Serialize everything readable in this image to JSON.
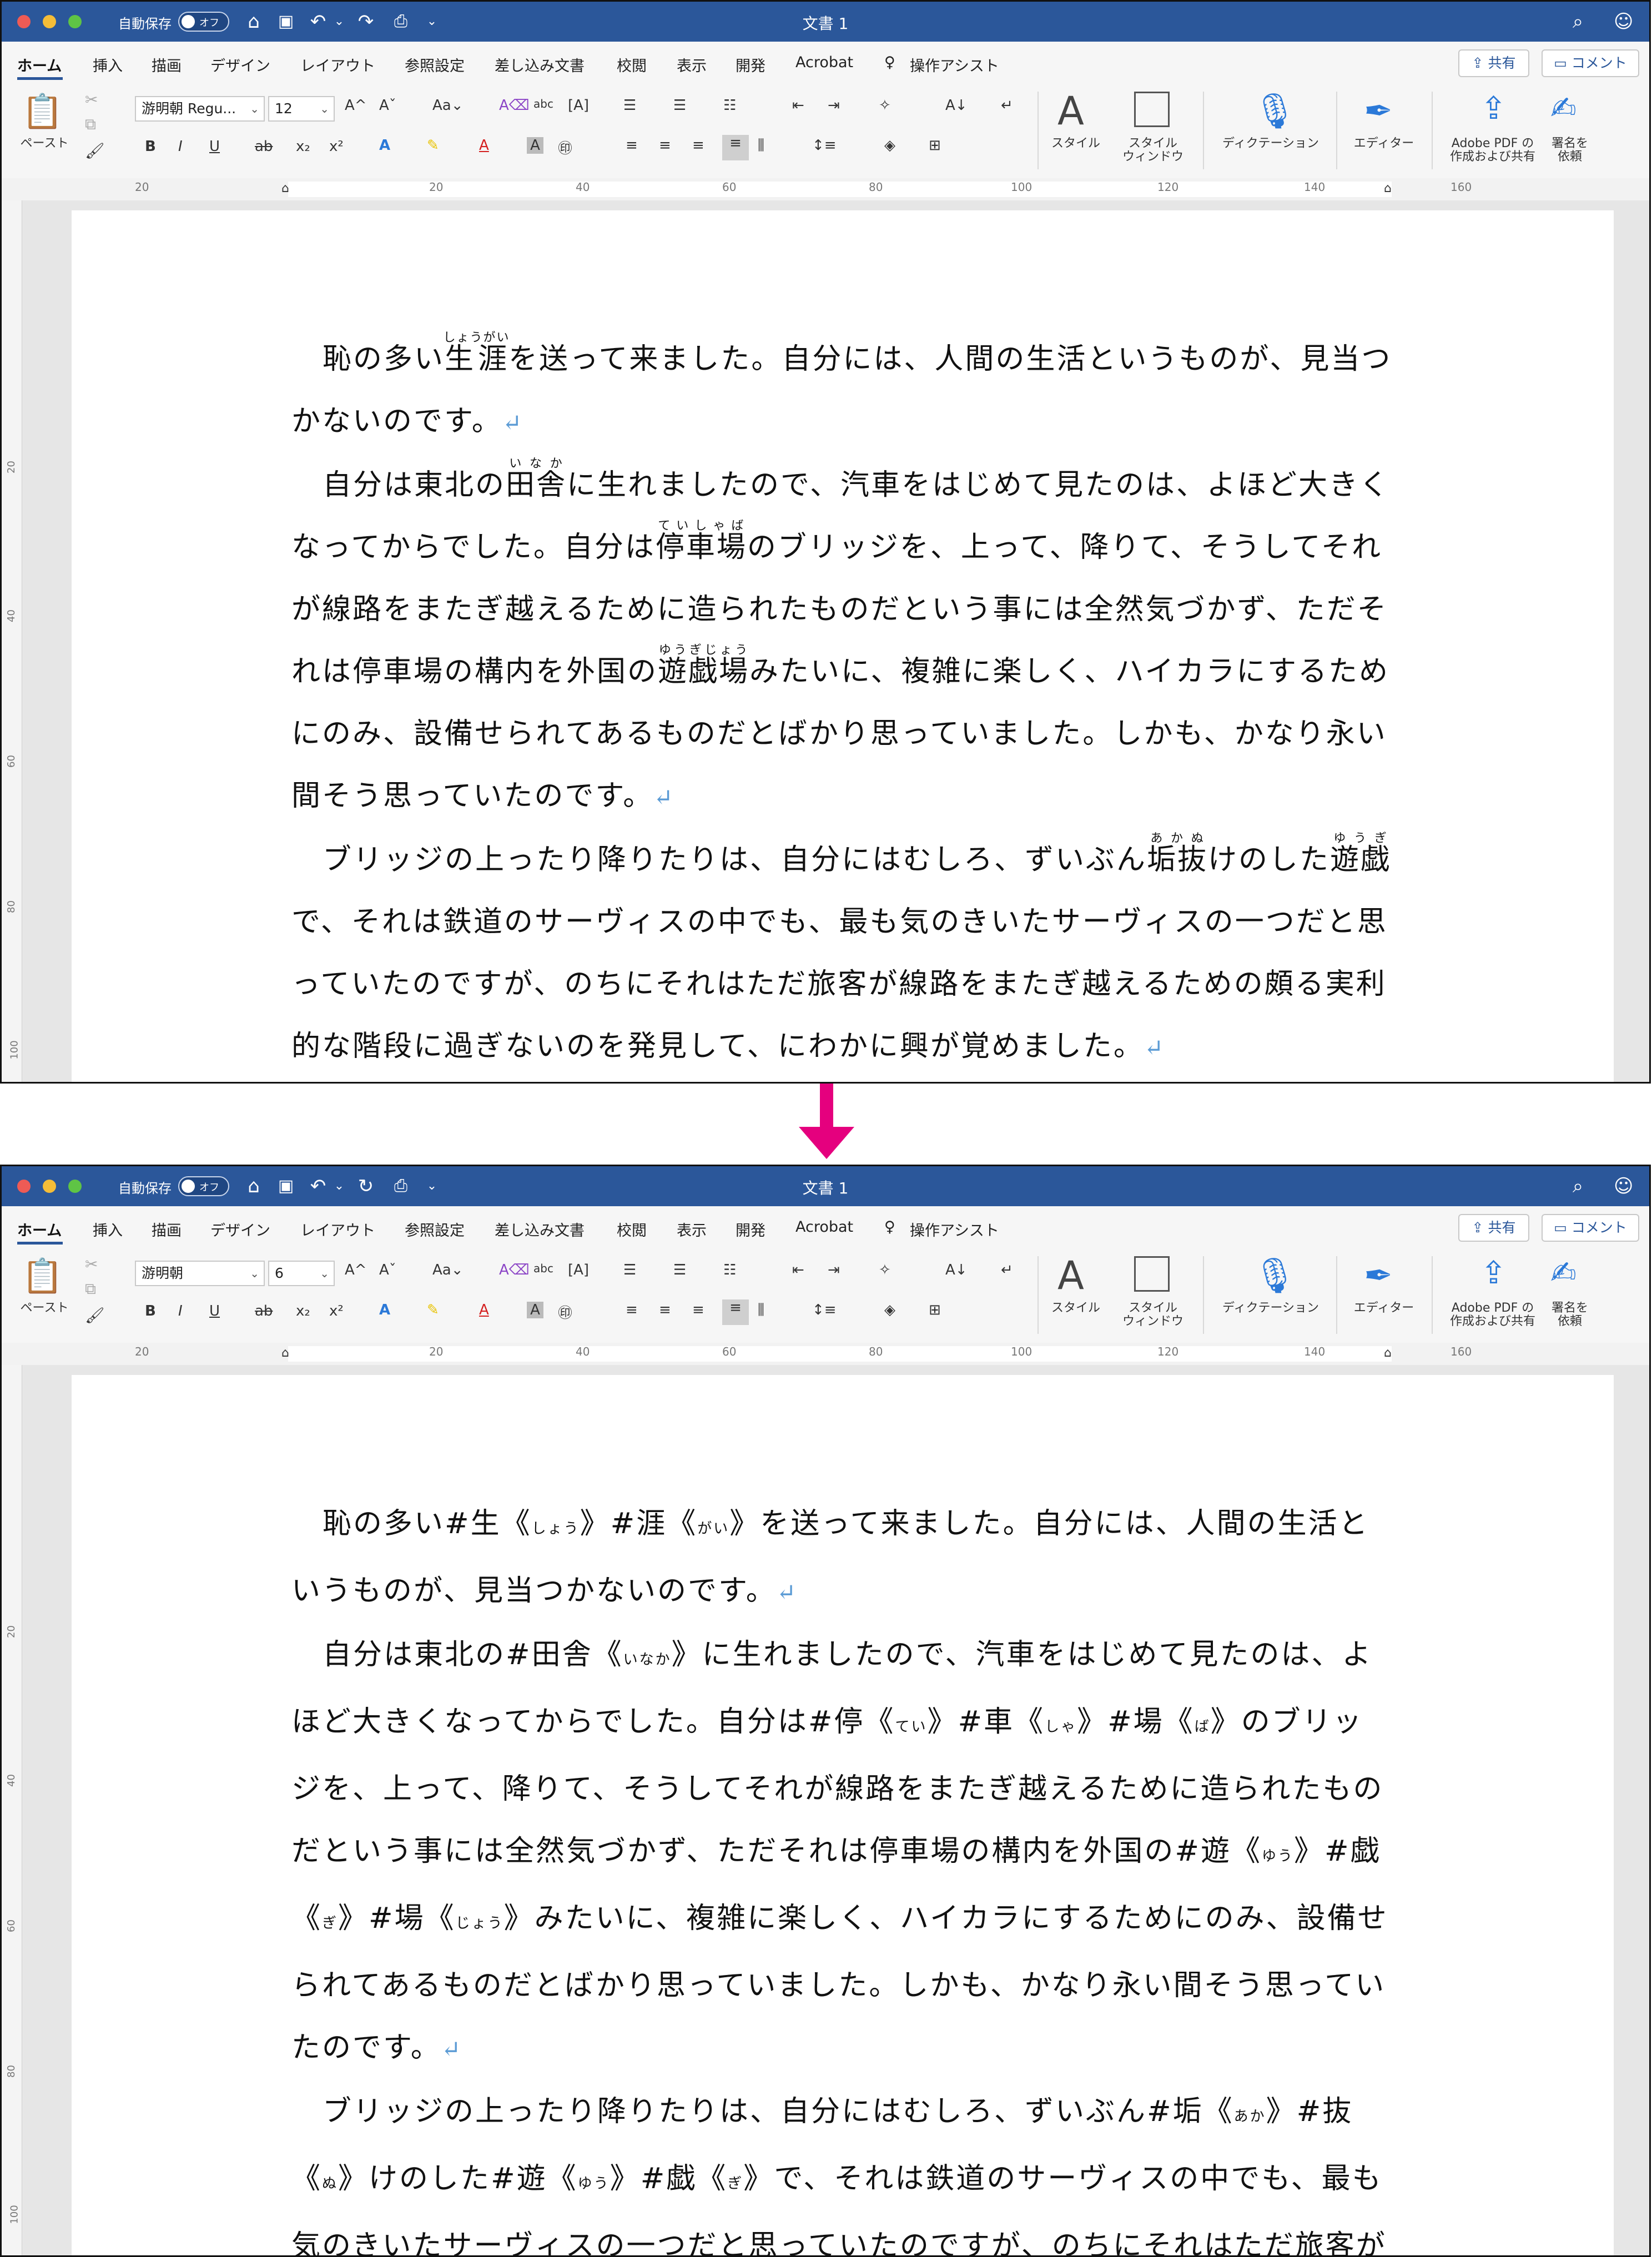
{
  "window": {
    "autosave_label": "自動保存",
    "autosave_state": "オフ",
    "title": "文書 1",
    "search_icon": "search-icon",
    "account_icon": "account-icon"
  },
  "tabs": [
    "ホーム",
    "挿入",
    "描画",
    "デザイン",
    "レイアウト",
    "参照設定",
    "差し込み文書",
    "校閲",
    "表示",
    "開発",
    "Acrobat",
    "操作アシスト"
  ],
  "share_label": "共有",
  "comment_label": "コメント",
  "ribbon": {
    "paste_label": "ペースト",
    "style_label": "スタイル",
    "style_window_label_1": "スタイル",
    "style_window_label_2": "ウィンドウ",
    "dictation_label": "ディクテーション",
    "editor_label": "エディター",
    "adobe_label_1": "Adobe PDF の",
    "adobe_label_2": "作成および共有",
    "sign_label_1": "署名を",
    "sign_label_2": "依頼",
    "bold": "B",
    "italic": "I",
    "underline": "U",
    "strike": "ab",
    "sub": "x₂",
    "sup": "x²"
  },
  "top": {
    "font_name": "游明朝 Regu...",
    "font_size": "12",
    "ruler_numbers": [
      "20",
      "20",
      "40",
      "60",
      "80",
      "100",
      "120",
      "140",
      "160"
    ],
    "vruler_numbers": [
      "20",
      "40",
      "60",
      "80",
      "100"
    ]
  },
  "bottom": {
    "font_name": "游明朝",
    "font_size": "6",
    "ruler_numbers": [
      "20",
      "20",
      "40",
      "60",
      "80",
      "100",
      "120",
      "140",
      "160"
    ],
    "vruler_numbers": [
      "20",
      "40",
      "60",
      "80",
      "100"
    ]
  },
  "top_doc": {
    "p1_a": "恥の多い",
    "p1_ruby_base": "生涯",
    "p1_ruby_text": "しょうがい",
    "p1_b": "を送って来ました。自分には、人間の生活というものが、見当つかないのです。",
    "p2_a": "自分は東北の",
    "p2_ruby1_base": "田舎",
    "p2_ruby1_text": "いなか",
    "p2_b": "に生れましたので、汽車をはじめて見たのは、よほど大きくなってからでした。自分は",
    "p2_ruby2_base": "停車場",
    "p2_ruby2_text": "ていしゃば",
    "p2_c": "のブリッジを、上って、降りて、そうしてそれが線路をまたぎ越えるために造られたものだという事には全然気づかず、ただそれは停車場の構内を外国の",
    "p2_ruby3_base": "遊戯場",
    "p2_ruby3_text": "ゆうぎじょう",
    "p2_d": "みたいに、複雑に楽しく、ハイカラにするためにのみ、設備せられてあるものだとばかり思っていました。しかも、かなり永い間そう思っていたのです。",
    "p3_a": "ブリッジの上ったり降りたりは、自分にはむしろ、ずいぶん",
    "p3_ruby1_base": "垢抜",
    "p3_ruby1_text": "あかぬ",
    "p3_b": "けのした",
    "p3_ruby2_base": "遊戯",
    "p3_ruby2_text": "ゆうぎ",
    "p3_c": "で、それは鉄道のサーヴィスの中でも、最も気のきいたサーヴィスの一つだと思っていたのですが、のちにそれはただ旅客が線路をまたぎ越えるための頗る実利的な階段に過ぎないのを発見して、にわかに興が覚めました。",
    "return_mark": "↵"
  },
  "bottom_doc": {
    "p1": [
      {
        "t": "恥の多い"
      },
      {
        "h": "#生",
        "r": "しょう"
      },
      {
        "h": "#涯",
        "r": "がい"
      },
      {
        "t": "を送って来ました。自分には、人間の生活というものが、見当つかないのです。"
      }
    ],
    "p2": [
      {
        "t": "自分は東北の"
      },
      {
        "h": "#田舎",
        "r": "いなか"
      },
      {
        "t": "に生れましたので、汽車をはじめて見たのは、よほど大きくなってからでした。自分は"
      },
      {
        "h": "#停",
        "r": "てい"
      },
      {
        "h": "#車",
        "r": "しゃ"
      },
      {
        "h": "#場",
        "r": "ば"
      },
      {
        "t": "のブリッジを、上って、降りて、そうしてそれが線路をまたぎ越えるために造られたものだという事には全然気づかず、ただそれは停車場の構内を外国の"
      },
      {
        "h": "#遊",
        "r": "ゆう"
      },
      {
        "h": "#戯",
        "r": "ぎ"
      },
      {
        "h": "#場",
        "r": "じょう"
      },
      {
        "t": "みたいに、複雑に楽しく、ハイカラにするためにのみ、設備せられてあるものだとばかり思っていました。しかも、かなり永い間そう思っていたのです。"
      }
    ],
    "p3": [
      {
        "t": "ブリッジの上ったり降りたりは、自分にはむしろ、ずいぶん"
      },
      {
        "h": "#垢",
        "r": "あか"
      },
      {
        "h": "#抜",
        "r": "ぬ"
      },
      {
        "t": "けのした"
      },
      {
        "h": "#遊",
        "r": "ゆう"
      },
      {
        "h": "#戯",
        "r": "ぎ"
      },
      {
        "t": "で、それは鉄道のサーヴィスの中でも、最も気のきいたサーヴィスの一つだと思っていたのですが、のちにそれはただ旅客が線"
      }
    ],
    "open_bracket": "《",
    "close_bracket": "》",
    "return_mark": "↵"
  },
  "colors": {
    "titlebar": "#2b579a",
    "arrow": "#e5007e",
    "return_mark": "#5b9bd5"
  }
}
